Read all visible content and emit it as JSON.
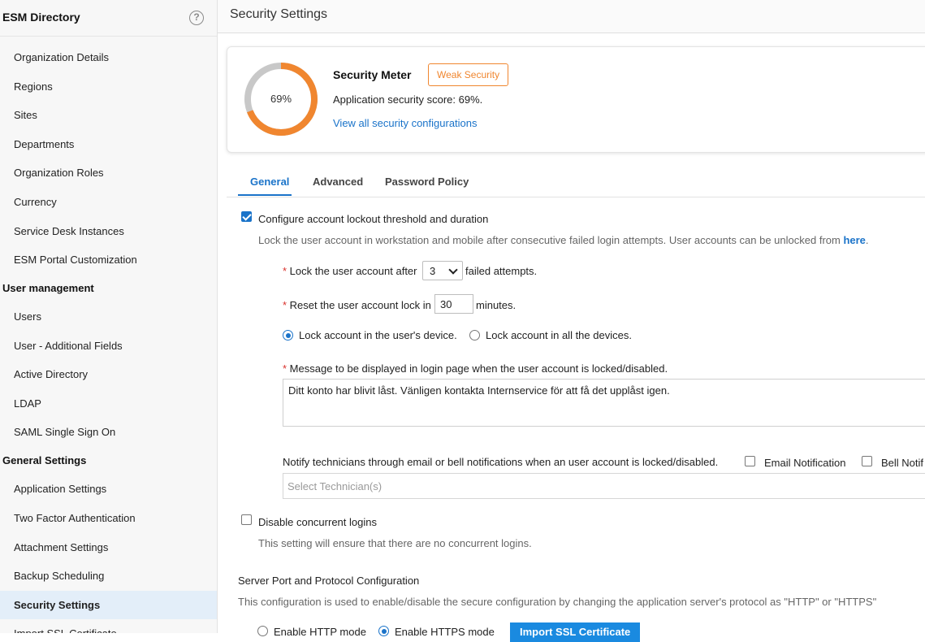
{
  "sidebar": {
    "title": "ESM Directory",
    "help_icon": "?",
    "items_top": [
      "Organization Details",
      "Regions",
      "Sites",
      "Departments",
      "Organization Roles",
      "Currency",
      "Service Desk Instances",
      "ESM Portal Customization"
    ],
    "section_user": "User management",
    "items_user": [
      "Users",
      "User - Additional Fields",
      "Active Directory",
      "LDAP",
      "SAML Single Sign On"
    ],
    "section_general": "General Settings",
    "items_general": [
      "Application Settings",
      "Two Factor Authentication",
      "Attachment Settings",
      "Backup Scheduling",
      "Security Settings",
      "Import SSL Certificate"
    ]
  },
  "header": {
    "title": "Security Settings"
  },
  "meter": {
    "percent_label": "69%",
    "percent_value": 69,
    "title": "Security Meter",
    "badge": "Weak Security",
    "score_text": "Application security score: 69%.",
    "link": "View all security configurations",
    "colors": {
      "fill": "#f0862f",
      "track": "#c8c8c8"
    }
  },
  "tabs": [
    "General",
    "Advanced",
    "Password Policy"
  ],
  "lockout": {
    "checkbox_label": "Configure account lockout threshold and duration",
    "description": "Lock the user account in workstation and mobile after consecutive failed login attempts. User accounts can be unlocked from",
    "here_link": "here",
    "lock_after_label": "Lock the user account after",
    "lock_after_value": "3",
    "failed_attempts": "failed attempts.",
    "reset_label": "Reset the user account lock in",
    "reset_value": "30",
    "minutes": "minutes.",
    "radio_device": "Lock account in the user's device.",
    "radio_all": "Lock account in all the devices.",
    "message_label": "Message to be displayed in login page when the user account is locked/disabled.",
    "message_value": "Ditt konto har blivit låst. Vänligen kontakta Internservice för att få det upplåst igen.",
    "notify_label": "Notify technicians through email or bell notifications when an user account is locked/disabled.",
    "email_notification": "Email Notification",
    "bell_notification": "Bell Notif",
    "technician_placeholder": "Select Technician(s)"
  },
  "concurrent": {
    "label": "Disable concurrent logins",
    "description": "This setting will ensure that there are no concurrent logins."
  },
  "server": {
    "title": "Server Port and Protocol Configuration",
    "description": "This configuration is used to enable/disable the secure configuration by changing the application server's protocol as \"HTTP\" or \"HTTPS\"",
    "http_mode": "Enable HTTP mode",
    "https_mode": "Enable HTTPS mode",
    "import_button": "Import SSL Certificate"
  }
}
